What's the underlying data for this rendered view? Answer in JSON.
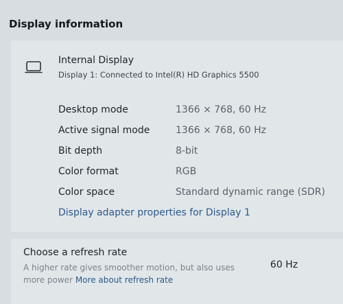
{
  "section": {
    "title": "Display information"
  },
  "display": {
    "icon": "laptop-monitor-icon",
    "name": "Internal Display",
    "subtitle": "Display 1: Connected to Intel(R) HD Graphics 5500"
  },
  "properties": [
    {
      "label": "Desktop mode",
      "value": "1366 × 768, 60 Hz"
    },
    {
      "label": "Active signal mode",
      "value": "1366 × 768, 60 Hz"
    },
    {
      "label": "Bit depth",
      "value": "8-bit"
    },
    {
      "label": "Color format",
      "value": "RGB"
    },
    {
      "label": "Color space",
      "value": "Standard dynamic range (SDR)"
    }
  ],
  "adapter_link": "Display adapter properties for Display 1",
  "refresh": {
    "title": "Choose a refresh rate",
    "description": "A higher rate gives smoother motion, but also uses more power",
    "link": "More about refresh rate",
    "value": "60 Hz"
  }
}
